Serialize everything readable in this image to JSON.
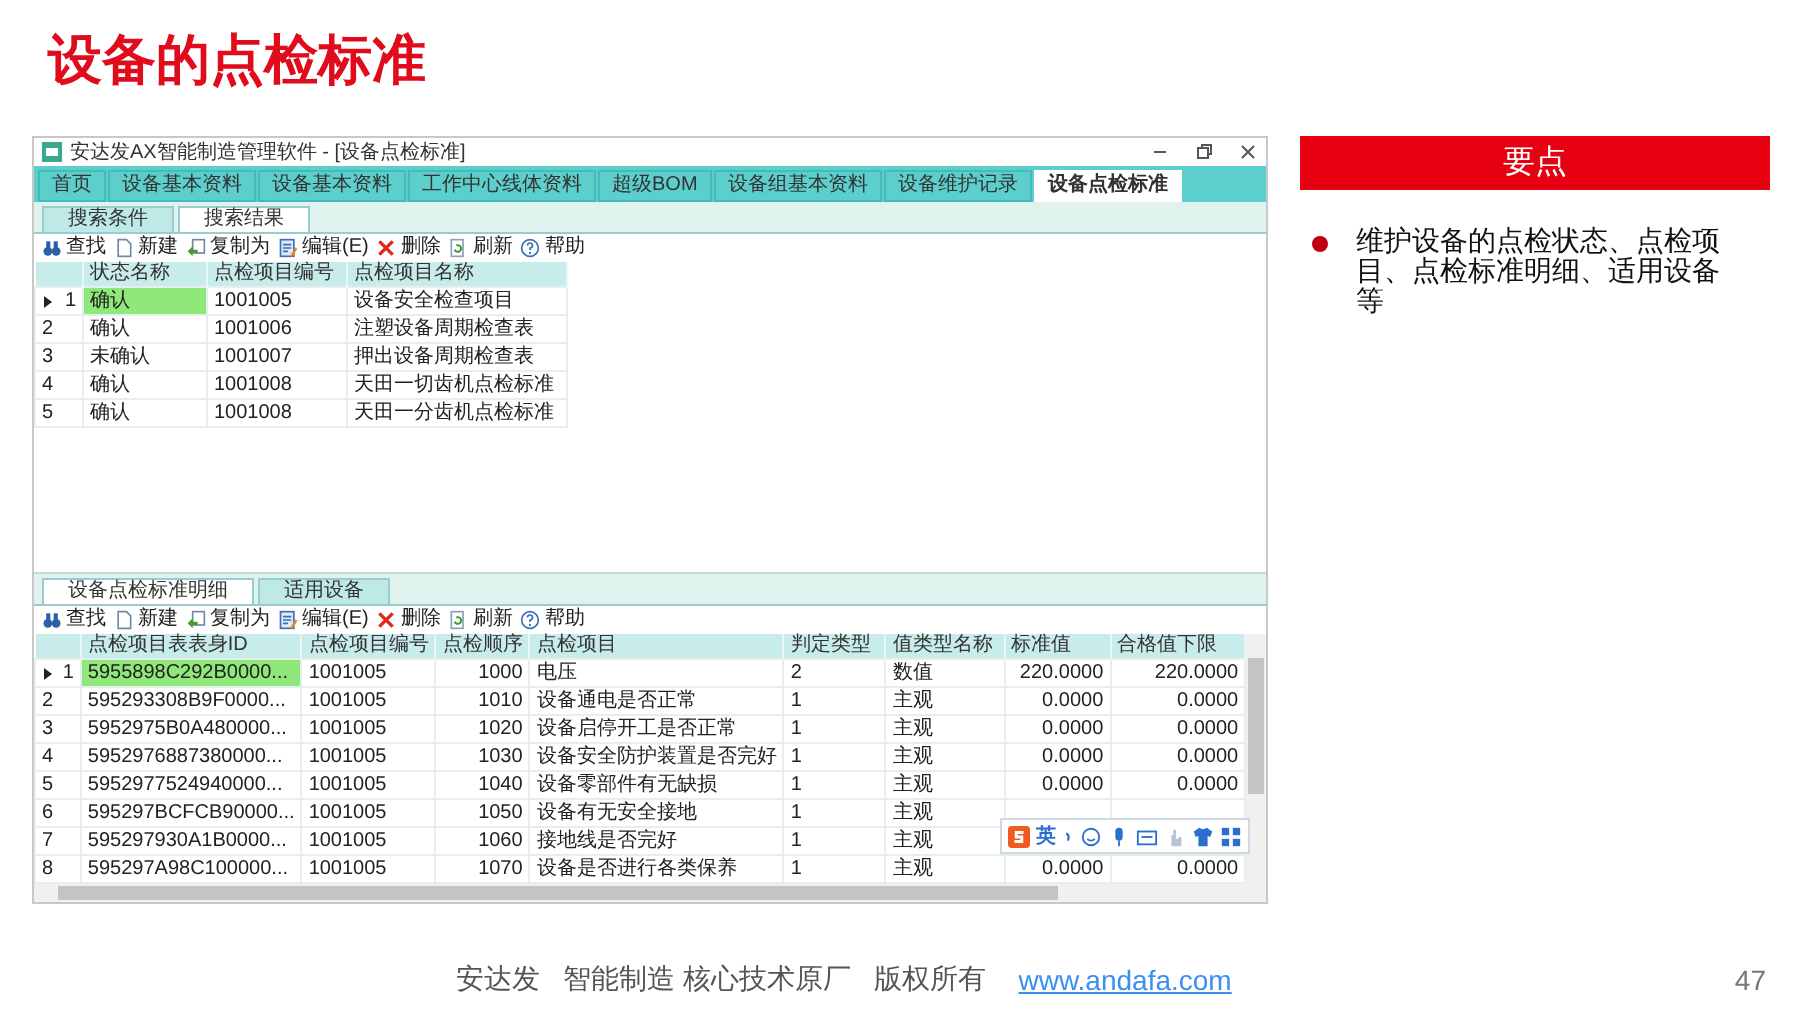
{
  "slide_title": "设备的点检标准",
  "window": {
    "title": "安达发AX智能制造管理软件 - [设备点检标准]",
    "tabs": [
      {
        "label": "首页",
        "selected": false
      },
      {
        "label": "设备基本资料",
        "selected": false
      },
      {
        "label": "设备基本资料",
        "selected": false
      },
      {
        "label": "工作中心线体资料",
        "selected": false
      },
      {
        "label": "超级BOM",
        "selected": false
      },
      {
        "label": "设备组基本资料",
        "selected": false
      },
      {
        "label": "设备维护记录",
        "selected": false
      },
      {
        "label": "设备点检标准",
        "selected": true
      }
    ],
    "search_tabs": [
      {
        "label": "搜索条件",
        "selected": false
      },
      {
        "label": "搜索结果",
        "selected": true
      }
    ],
    "toolbar": [
      "查找",
      "新建",
      "复制为",
      "编辑(E)",
      "删除",
      "刷新",
      "帮助"
    ],
    "master_table": {
      "columns": [
        "状态名称",
        "点检项目编号",
        "点检项目名称"
      ],
      "rows": [
        {
          "number": "1",
          "selected": true,
          "cells": [
            "确认",
            "1001005",
            "设备安全检查项目"
          ]
        },
        {
          "number": "2",
          "selected": false,
          "cells": [
            "确认",
            "1001006",
            "注塑设备周期检查表"
          ]
        },
        {
          "number": "3",
          "selected": false,
          "cells": [
            "未确认",
            "1001007",
            "押出设备周期检查表"
          ]
        },
        {
          "number": "4",
          "selected": false,
          "cells": [
            "确认",
            "1001008",
            "天田一切齿机点检标准"
          ]
        },
        {
          "number": "5",
          "selected": false,
          "cells": [
            "确认",
            "1001008",
            "天田一分齿机点检标准"
          ]
        }
      ]
    },
    "detail_tabs": [
      {
        "label": "设备点检标准明细",
        "selected": true
      },
      {
        "label": "适用设备",
        "selected": false
      }
    ],
    "detail_toolbar": [
      "查找",
      "新建",
      "复制为",
      "编辑(E)",
      "删除",
      "刷新",
      "帮助"
    ],
    "detail_table": {
      "columns": [
        "点检项目表表身ID",
        "点检项目编号",
        "点检顺序",
        "点检项目",
        "判定类型",
        "值类型名称",
        "标准值",
        "合格值下限"
      ],
      "rows": [
        {
          "number": "1",
          "selected": true,
          "cells": [
            "5955898C292B0000...",
            "1001005",
            "1000",
            "电压",
            "2",
            "数值",
            "220.0000",
            "220.0000"
          ]
        },
        {
          "number": "2",
          "selected": false,
          "cells": [
            "595293308B9F0000...",
            "1001005",
            "1010",
            "设备通电是否正常",
            "1",
            "主观",
            "0.0000",
            "0.0000"
          ]
        },
        {
          "number": "3",
          "selected": false,
          "cells": [
            "5952975B0A480000...",
            "1001005",
            "1020",
            "设备启停开工是否正常",
            "1",
            "主观",
            "0.0000",
            "0.0000"
          ]
        },
        {
          "number": "4",
          "selected": false,
          "cells": [
            "5952976887380000...",
            "1001005",
            "1030",
            "设备安全防护装置是否完好",
            "1",
            "主观",
            "0.0000",
            "0.0000"
          ]
        },
        {
          "number": "5",
          "selected": false,
          "cells": [
            "5952977524940000...",
            "1001005",
            "1040",
            "设备零部件有无缺损",
            "1",
            "主观",
            "0.0000",
            "0.0000"
          ]
        },
        {
          "number": "6",
          "selected": false,
          "cells": [
            "595297BCFCB90000...",
            "1001005",
            "1050",
            "设备有无安全接地",
            "1",
            "主观"
          ]
        },
        {
          "number": "7",
          "selected": false,
          "cells": [
            "595297930A1B0000...",
            "1001005",
            "1060",
            "接地线是否完好",
            "1",
            "主观"
          ]
        },
        {
          "number": "8",
          "selected": false,
          "cells": [
            "595297A98C100000...",
            "1001005",
            "1070",
            "设备是否进行各类保养",
            "1",
            "主观",
            "0.0000",
            "0.0000"
          ]
        }
      ]
    },
    "ime_toolbar": {
      "mode": "英"
    }
  },
  "key_points": {
    "heading": "要点",
    "items": [
      "维护设备的点检状态、点检项目、点检标准明细、适用设备等"
    ]
  },
  "footer": {
    "text": "安达发   智能制造 核心技术原厂   版权所有",
    "link": "www.andafa.com",
    "page": "47"
  }
}
